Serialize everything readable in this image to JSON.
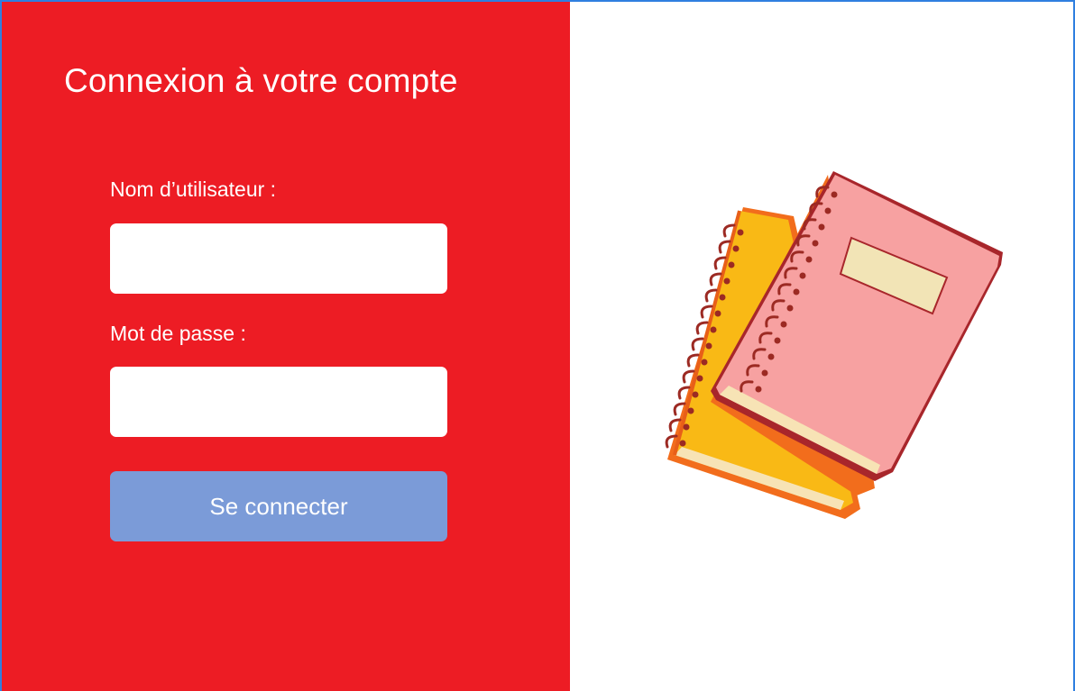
{
  "login": {
    "title": "Connexion à votre compte",
    "username_label": "Nom d’utilisateur :",
    "username_value": "",
    "password_label": "Mot de passe :",
    "password_value": "",
    "submit_label": "Se connecter"
  },
  "theme": {
    "panel_color": "#ed1c24",
    "button_color": "#7b9bd8",
    "frame_border_color": "#2f7fe0"
  },
  "illustration": {
    "icon": "notebooks-icon"
  }
}
